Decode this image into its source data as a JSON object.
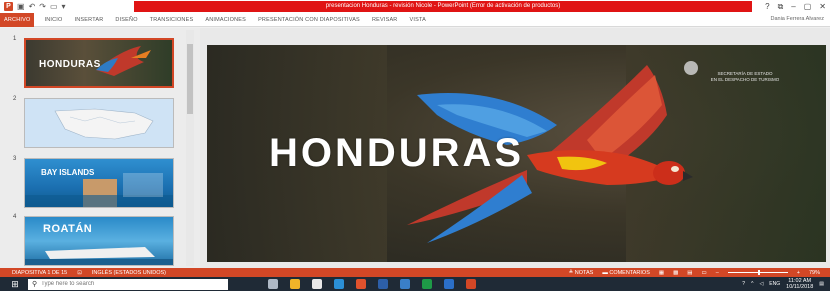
{
  "window": {
    "title": "presentacion Honduras - revisión Nicole - PowerPoint (Error de activación de productos)",
    "controls": [
      "?",
      "⧉",
      "–",
      "▢",
      "✕"
    ],
    "user": "Dania Ferrera Alvarez"
  },
  "ribbon": {
    "tabs": [
      "ARCHIVO",
      "INICIO",
      "INSERTAR",
      "DISEÑO",
      "TRANSICIONES",
      "ANIMACIONES",
      "PRESENTACIÓN CON DIAPOSITIVAS",
      "REVISAR",
      "VISTA"
    ]
  },
  "thumbnails": [
    {
      "number": "1",
      "label": "HONDURAS"
    },
    {
      "number": "2",
      "label": ""
    },
    {
      "number": "3",
      "label": "BAY ISLANDS"
    },
    {
      "number": "4",
      "label": "ROATÁN"
    }
  ],
  "slide": {
    "title": "HONDURAS",
    "gov_line1": "SECRETARÍA DE ESTADO",
    "gov_line2": "EN EL DESPACHO DE TURISMO"
  },
  "status": {
    "slide_info": "DIAPOSITIVA 1 DE 15",
    "language": "INGLÉS (ESTADOS UNIDOS)",
    "notes": "NOTAS",
    "comments": "COMENTARIOS",
    "zoom": "79%"
  },
  "taskbar": {
    "search_placeholder": "Type here to search",
    "lang": "ENG",
    "time": "11:02 AM",
    "date": "10/11/2018"
  },
  "colors": {
    "accent": "#d24726",
    "title_bar_error": "#e01414",
    "taskbar": "#1f2a36"
  }
}
